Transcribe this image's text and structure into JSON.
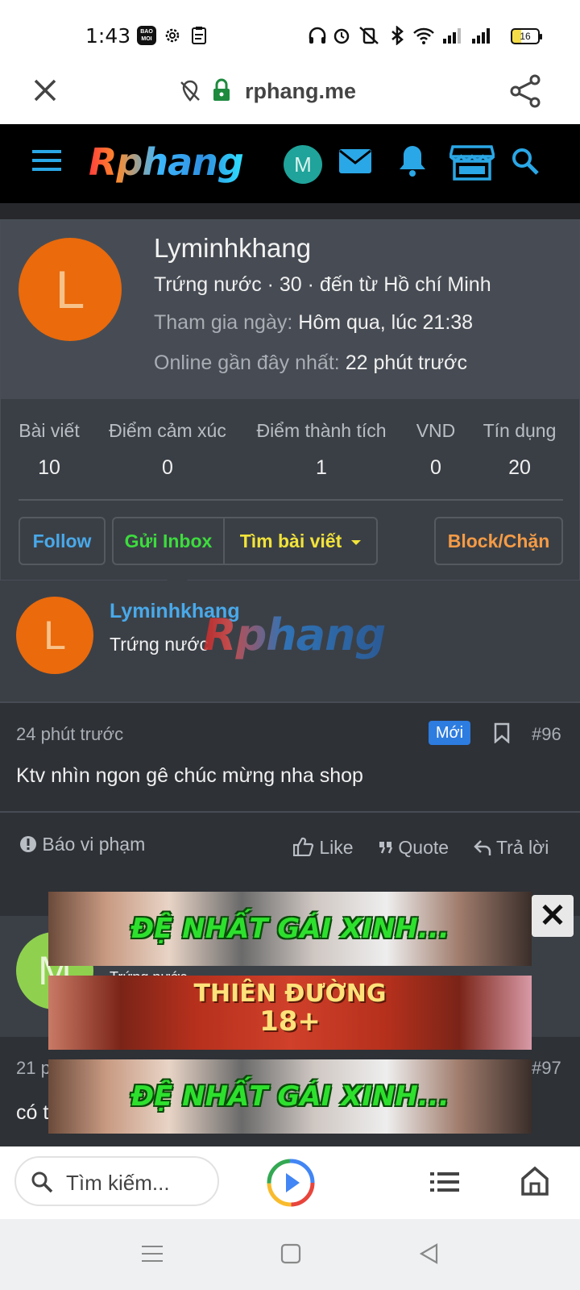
{
  "status_bar": {
    "time": "1:43",
    "baomoi_label": "BAO MOI",
    "battery": "16"
  },
  "browser": {
    "url": "rphang.me",
    "search_placeholder": "Tìm kiếm..."
  },
  "site": {
    "logo": "Rphang",
    "user_initial": "M"
  },
  "profile": {
    "initial": "L",
    "name": "Lyminhkhang",
    "meta": "Trứng nước · 30 · đến từ Hồ chí Minh",
    "joined_label": "Tham gia ngày:",
    "joined_value": "Hôm qua, lúc 21:38",
    "online_label": "Online gần đây nhất:",
    "online_value": "22 phút trước",
    "stats": [
      {
        "label": "Bài viết",
        "value": "10"
      },
      {
        "label": "Điểm cảm xúc",
        "value": "0"
      },
      {
        "label": "Điểm thành tích",
        "value": "1"
      },
      {
        "label": "VND",
        "value": "0"
      },
      {
        "label": "Tín dụng",
        "value": "20"
      }
    ],
    "buttons": {
      "follow": "Follow",
      "inbox": "Gửi Inbox",
      "find_posts": "Tìm bài viết",
      "block": "Block/Chặn"
    }
  },
  "post": {
    "author_initial": "L",
    "author_name": "Lyminhkhang",
    "author_title": "Trứng nước",
    "watermark": "Rphang",
    "time": "24 phút trước",
    "badge": "Mới",
    "number": "#96",
    "text": "Ktv nhìn ngon gê chúc mừng nha shop",
    "report": "Báo vi phạm",
    "like": "Like",
    "quote": "Quote",
    "reply": "Trả lời"
  },
  "next_post": {
    "author_initial": "M",
    "author_title": "Trứng nước",
    "time": "21 p",
    "number": "#97",
    "text": "có t"
  },
  "ads": {
    "banner1": "ĐỆ NHẤT GÁI XINH...",
    "banner2_line1": "THIÊN ĐƯỜNG",
    "banner2_line2": "18+",
    "banner3": "ĐỆ NHẤT GÁI XINH...",
    "close": "✕"
  },
  "colors": {
    "link": "#49a9ea",
    "inbox": "#3ddc3d",
    "find": "#f2e33a",
    "block": "#f59b45",
    "badge": "#2d7ce0",
    "avatar_orange": "#ea6a0c"
  }
}
